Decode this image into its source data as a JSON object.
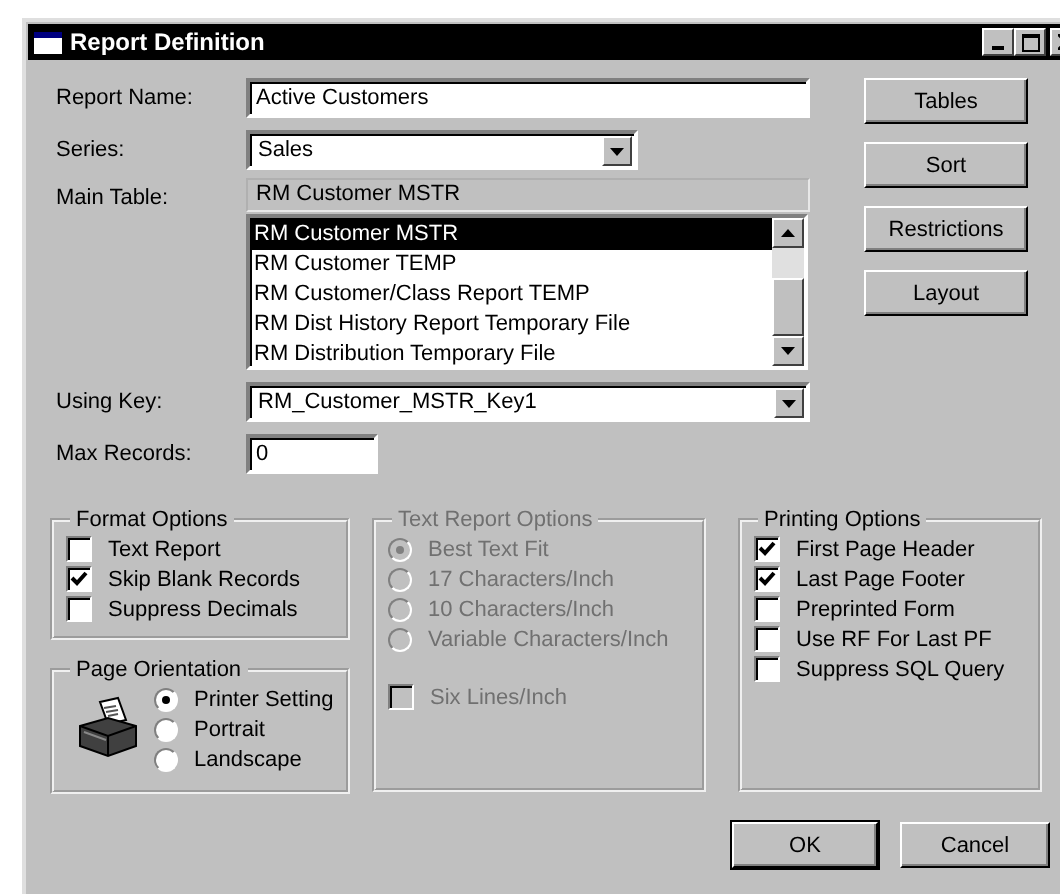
{
  "window": {
    "title": "Report Definition"
  },
  "report_name": {
    "label": "Report Name:",
    "value": "Active Customers"
  },
  "series": {
    "label": "Series:",
    "value": "Sales"
  },
  "main_table": {
    "label": "Main Table:",
    "value": "RM Customer MSTR",
    "list": [
      {
        "label": "RM Customer MSTR",
        "selected": true
      },
      {
        "label": "RM Customer TEMP",
        "selected": false
      },
      {
        "label": "RM Customer/Class Report TEMP",
        "selected": false
      },
      {
        "label": "RM Dist History Report Temporary File",
        "selected": false
      },
      {
        "label": "RM Distribution Temporary File",
        "selected": false
      }
    ]
  },
  "using_key": {
    "label": "Using Key:",
    "value": "RM_Customer_MSTR_Key1"
  },
  "max_records": {
    "label": "Max Records:",
    "value": "0"
  },
  "side_buttons": [
    {
      "label": "Tables"
    },
    {
      "label": "Sort"
    },
    {
      "label": "Restrictions"
    },
    {
      "label": "Layout"
    }
  ],
  "format_options": {
    "title": "Format Options",
    "disabled": false,
    "items": [
      {
        "kind": "checkbox",
        "label": "Text Report",
        "checked": false
      },
      {
        "kind": "checkbox",
        "label": "Skip Blank Records",
        "checked": true
      },
      {
        "kind": "checkbox",
        "label": "Suppress Decimals",
        "checked": false
      }
    ]
  },
  "page_orientation": {
    "title": "Page Orientation",
    "disabled": false,
    "items": [
      {
        "kind": "radio",
        "label": "Printer Setting",
        "selected": true
      },
      {
        "kind": "radio",
        "label": "Portrait",
        "selected": false
      },
      {
        "kind": "radio",
        "label": "Landscape",
        "selected": false
      }
    ]
  },
  "text_report_options": {
    "title": "Text Report Options",
    "disabled": true,
    "items": [
      {
        "kind": "radio",
        "label": "Best Text Fit",
        "selected": true
      },
      {
        "kind": "radio",
        "label": "17 Characters/Inch",
        "selected": false
      },
      {
        "kind": "radio",
        "label": "10 Characters/Inch",
        "selected": false
      },
      {
        "kind": "radio",
        "label": "Variable Characters/Inch",
        "selected": false
      },
      {
        "kind": "checkbox",
        "label": "Six Lines/Inch",
        "checked": false
      }
    ]
  },
  "printing_options": {
    "title": "Printing Options",
    "disabled": false,
    "items": [
      {
        "kind": "checkbox",
        "label": "First Page Header",
        "checked": true
      },
      {
        "kind": "checkbox",
        "label": "Last Page Footer",
        "checked": true
      },
      {
        "kind": "checkbox",
        "label": "Preprinted Form",
        "checked": false
      },
      {
        "kind": "checkbox",
        "label": "Use RF For Last PF",
        "checked": false
      },
      {
        "kind": "checkbox",
        "label": "Suppress SQL Query",
        "checked": false
      }
    ]
  },
  "buttons": [
    {
      "label": "OK"
    },
    {
      "label": "Cancel"
    }
  ]
}
